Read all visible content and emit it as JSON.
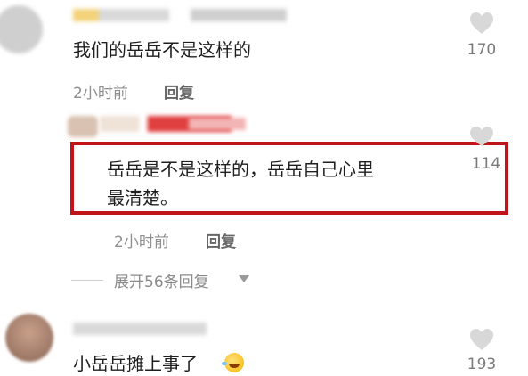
{
  "comments": [
    {
      "text": "我们的岳岳不是这样的",
      "time": "2小时前",
      "reply": "回复",
      "likes": "170"
    },
    {
      "text_line1": "岳岳是不是这样的，岳岳自己心里",
      "text_line2": "最清楚。",
      "time": "2小时前",
      "reply": "回复",
      "likes": "114"
    },
    {
      "text": "小岳岳摊上事了",
      "likes": "193"
    }
  ],
  "expand_replies": "展开56条回复",
  "icons": {
    "like": "heart-icon",
    "expand": "caret-down-icon",
    "emoji": "laughing-tears-emoji-icon"
  },
  "colors": {
    "highlight_border": "#c0141a",
    "text": "#1f1f1f",
    "meta": "#8f8f8f"
  }
}
